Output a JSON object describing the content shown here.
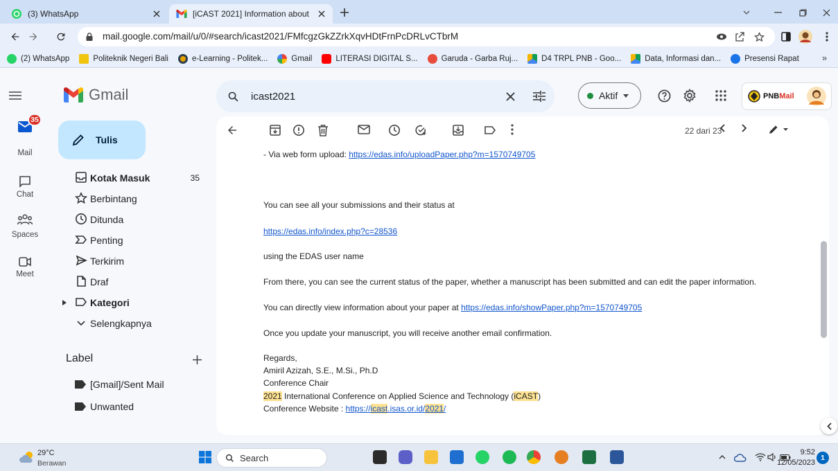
{
  "browser": {
    "tabs": [
      {
        "title": "(3) WhatsApp",
        "favicon": "whatsapp-icon"
      },
      {
        "title": "[iCAST 2021] Information about",
        "favicon": "gmail-icon"
      }
    ],
    "url": "mail.google.com/mail/u/0/#search/icast2021/FMfcgzGkZZrkXqvHDtFrnPcDRLvCTbrM",
    "bookmarks": [
      {
        "label": "(2) WhatsApp",
        "icon": "whatsapp-icon"
      },
      {
        "label": "Politeknik Negeri Bali",
        "icon": "pnb-logo-icon"
      },
      {
        "label": "e-Learning - Politek...",
        "icon": "elearning-icon"
      },
      {
        "label": "Gmail",
        "icon": "google-icon"
      },
      {
        "label": "LITERASI DIGITAL S...",
        "icon": "youtube-icon"
      },
      {
        "label": "Garuda - Garba Ruj...",
        "icon": "garuda-icon"
      },
      {
        "label": "D4 TRPL PNB - Goo...",
        "icon": "drive-icon"
      },
      {
        "label": "Data, Informasi dan...",
        "icon": "drive-icon"
      },
      {
        "label": "Presensi Rapat",
        "icon": "globe-icon"
      }
    ],
    "bookmarks_more": "»"
  },
  "gmail": {
    "app_name": "Gmail",
    "search": {
      "value": "icast2021"
    },
    "status": {
      "label": "Aktif"
    },
    "account_logo": {
      "prefix": "PNB",
      "suffix": "Mail"
    },
    "rail": [
      {
        "label": "Mail",
        "badge": "35",
        "icon": "mail-icon"
      },
      {
        "label": "Chat",
        "icon": "chat-icon"
      },
      {
        "label": "Spaces",
        "icon": "spaces-icon"
      },
      {
        "label": "Meet",
        "icon": "meet-icon"
      }
    ],
    "compose_label": "Tulis",
    "nav": [
      {
        "label": "Kotak Masuk",
        "count": "35",
        "icon": "inbox-icon"
      },
      {
        "label": "Berbintang",
        "icon": "star-icon"
      },
      {
        "label": "Ditunda",
        "icon": "snooze-icon"
      },
      {
        "label": "Penting",
        "icon": "important-icon"
      },
      {
        "label": "Terkirim",
        "icon": "send-icon"
      },
      {
        "label": "Draf",
        "icon": "draft-icon"
      },
      {
        "label": "Kategori",
        "icon": "label-icon"
      },
      {
        "label": "Selengkapnya",
        "icon": "chevron-down-icon"
      }
    ],
    "labels_header": "Label",
    "labels": [
      {
        "label": "[Gmail]/Sent Mail",
        "icon": "label-filled-icon"
      },
      {
        "label": "Unwanted",
        "icon": "label-filled-icon"
      }
    ],
    "toolbar": {
      "counter": "22 dari 23"
    },
    "message": {
      "upload_prefix": "- Via web form upload: ",
      "upload_link": "https://edas.info/uploadPaper.php?m=1570749705",
      "submissions_text": "You can see all your submissions and their status at",
      "index_link": "https://edas.info/index.php?c=28536",
      "username_text": "using the EDAS user name",
      "from_there_text": "From there, you can see the current status of the paper, whether a manuscript has been submitted and can edit the paper information.",
      "view_prefix": "You can directly view information about your paper at ",
      "view_link": "https://edas.info/showPaper.php?m=1570749705",
      "update_text": "Once you update your manuscript, you will receive another email confirmation.",
      "signature": {
        "regards": "Regards,",
        "name": "Amiril Azizah, S.E., M.Si., Ph.D",
        "role": "Conference Chair",
        "event": [
          {
            "text": "2021",
            "hl": true
          },
          {
            "text": " International Conference on Applied Science and Technology (",
            "hl": false
          },
          {
            "text": "iCAST",
            "hl": true
          },
          {
            "text": ")",
            "hl": false
          }
        ],
        "website_label": "Conference Website : ",
        "website_link": [
          {
            "text": "https://",
            "hl": false
          },
          {
            "text": "icast",
            "hl": true
          },
          {
            "text": ".isas.or.id/",
            "hl": false
          },
          {
            "text": "2021",
            "hl": true
          },
          {
            "text": "/",
            "hl": false
          }
        ]
      }
    }
  },
  "taskbar": {
    "weather": {
      "temp": "29°C",
      "condition": "Berawan"
    },
    "search_label": "Search",
    "clock": {
      "time": "9:52",
      "date": "12/05/2023"
    },
    "notification_count": "1"
  },
  "colors": {
    "compose_bg": "#c2e7ff",
    "badge_red": "#d93025",
    "link": "#1155cc",
    "highlight": "#fde293",
    "status_green": "#1e8e3e",
    "search_bg": "#eaf1fb"
  }
}
